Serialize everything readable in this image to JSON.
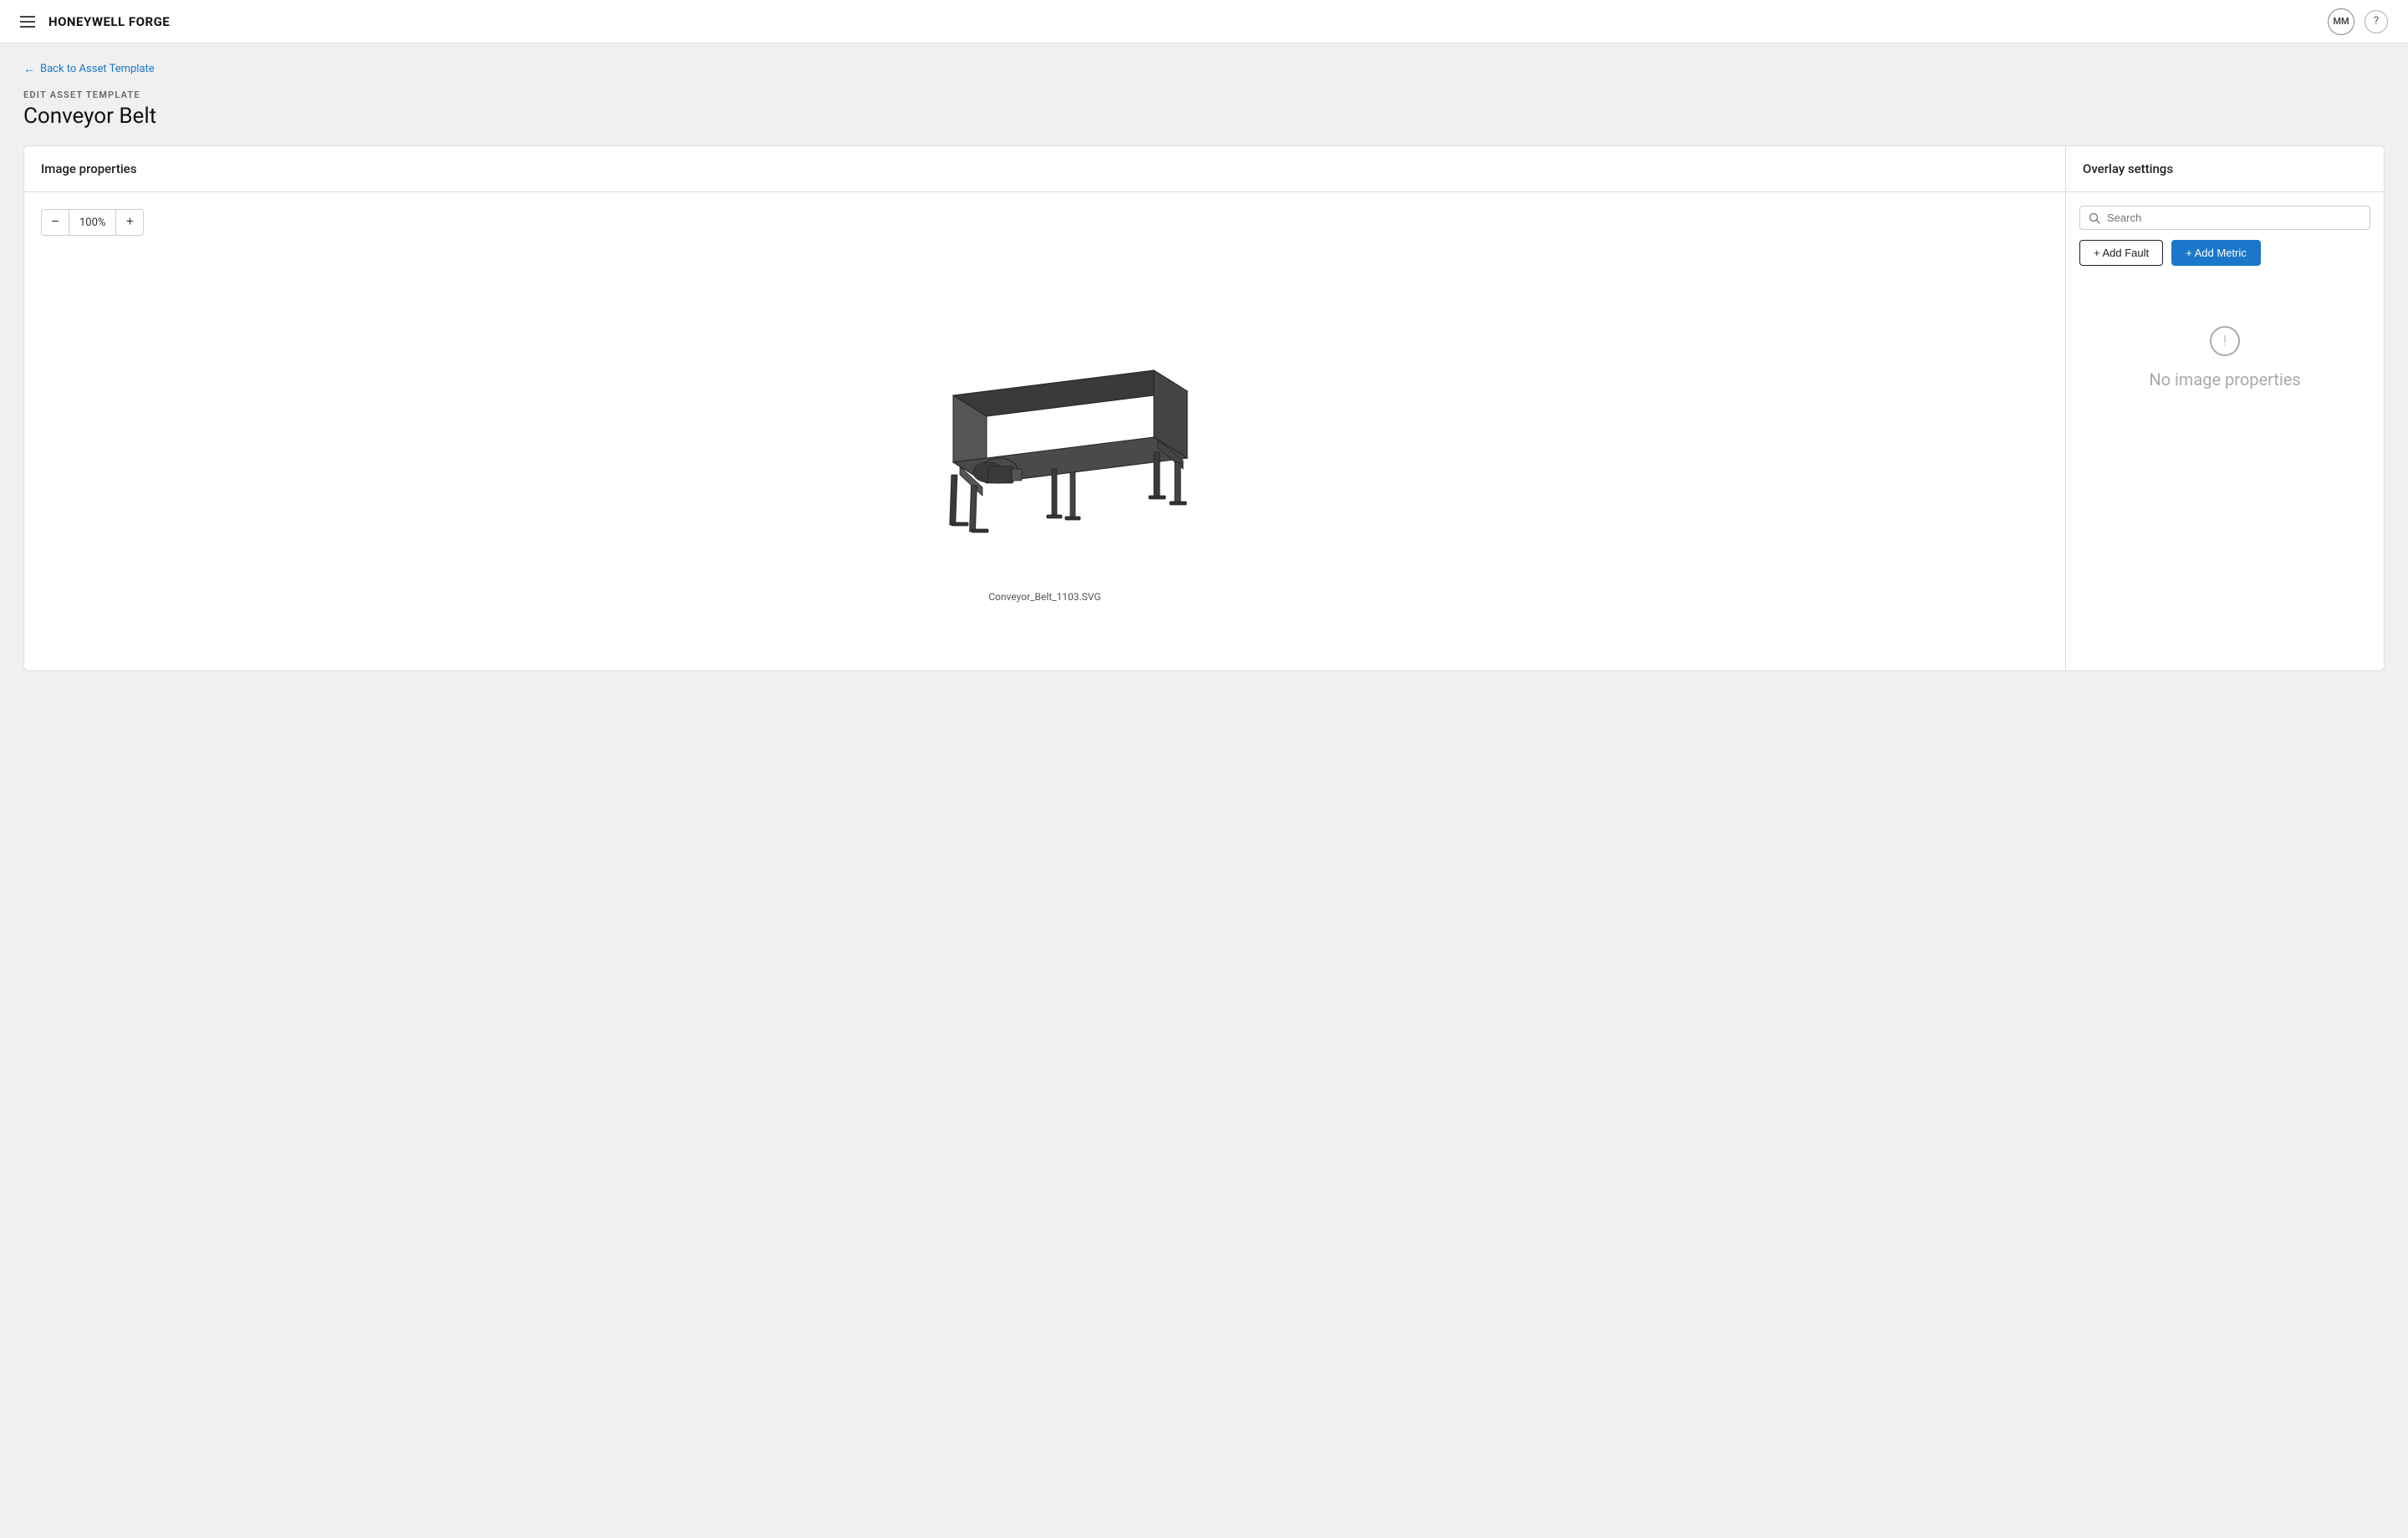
{
  "header": {
    "brand": "HONEYWELL FORGE",
    "avatar_initials": "MM",
    "help_icon": "?"
  },
  "back_link": {
    "label": "Back to Asset Template"
  },
  "page": {
    "label": "EDIT ASSET TEMPLATE",
    "title": "Conveyor Belt"
  },
  "left_panel": {
    "header": "Image properties",
    "zoom_value": "100%",
    "zoom_decrease_label": "−",
    "zoom_increase_label": "+",
    "image_filename": "Conveyor_Belt_1103.SVG"
  },
  "right_panel": {
    "header": "Overlay settings",
    "search_placeholder": "Search",
    "add_fault_label": "+ Add Fault",
    "add_metric_label": "+ Add Metric",
    "empty_state_text": "No image properties"
  }
}
